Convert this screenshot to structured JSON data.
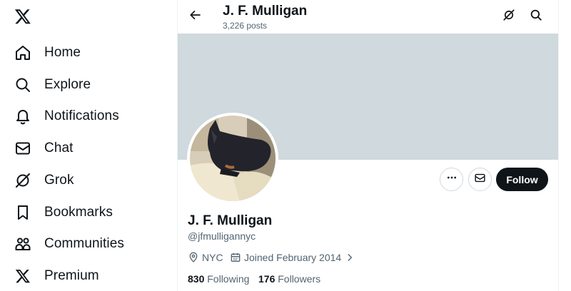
{
  "sidebar": {
    "logo": "x-logo-icon",
    "items": [
      {
        "label": "Home",
        "icon": "home-icon"
      },
      {
        "label": "Explore",
        "icon": "search-icon"
      },
      {
        "label": "Notifications",
        "icon": "bell-icon"
      },
      {
        "label": "Chat",
        "icon": "mail-icon"
      },
      {
        "label": "Grok",
        "icon": "grok-icon"
      },
      {
        "label": "Bookmarks",
        "icon": "bookmark-icon"
      },
      {
        "label": "Communities",
        "icon": "communities-icon"
      },
      {
        "label": "Premium",
        "icon": "x-premium-icon"
      }
    ]
  },
  "header": {
    "name": "J. F. Mulligan",
    "posts": "3,226 posts"
  },
  "profile": {
    "name": "J. F. Mulligan",
    "handle": "@jfmulligannyc",
    "location": "NYC",
    "joined": "Joined February 2014",
    "following_count": "830",
    "following_label": "Following",
    "followers_count": "176",
    "followers_label": "Followers",
    "follow_label": "Follow"
  },
  "colors": {
    "text": "#0f1419",
    "secondary": "#536471",
    "banner": "#cfd9de",
    "border": "#cfd9de"
  }
}
